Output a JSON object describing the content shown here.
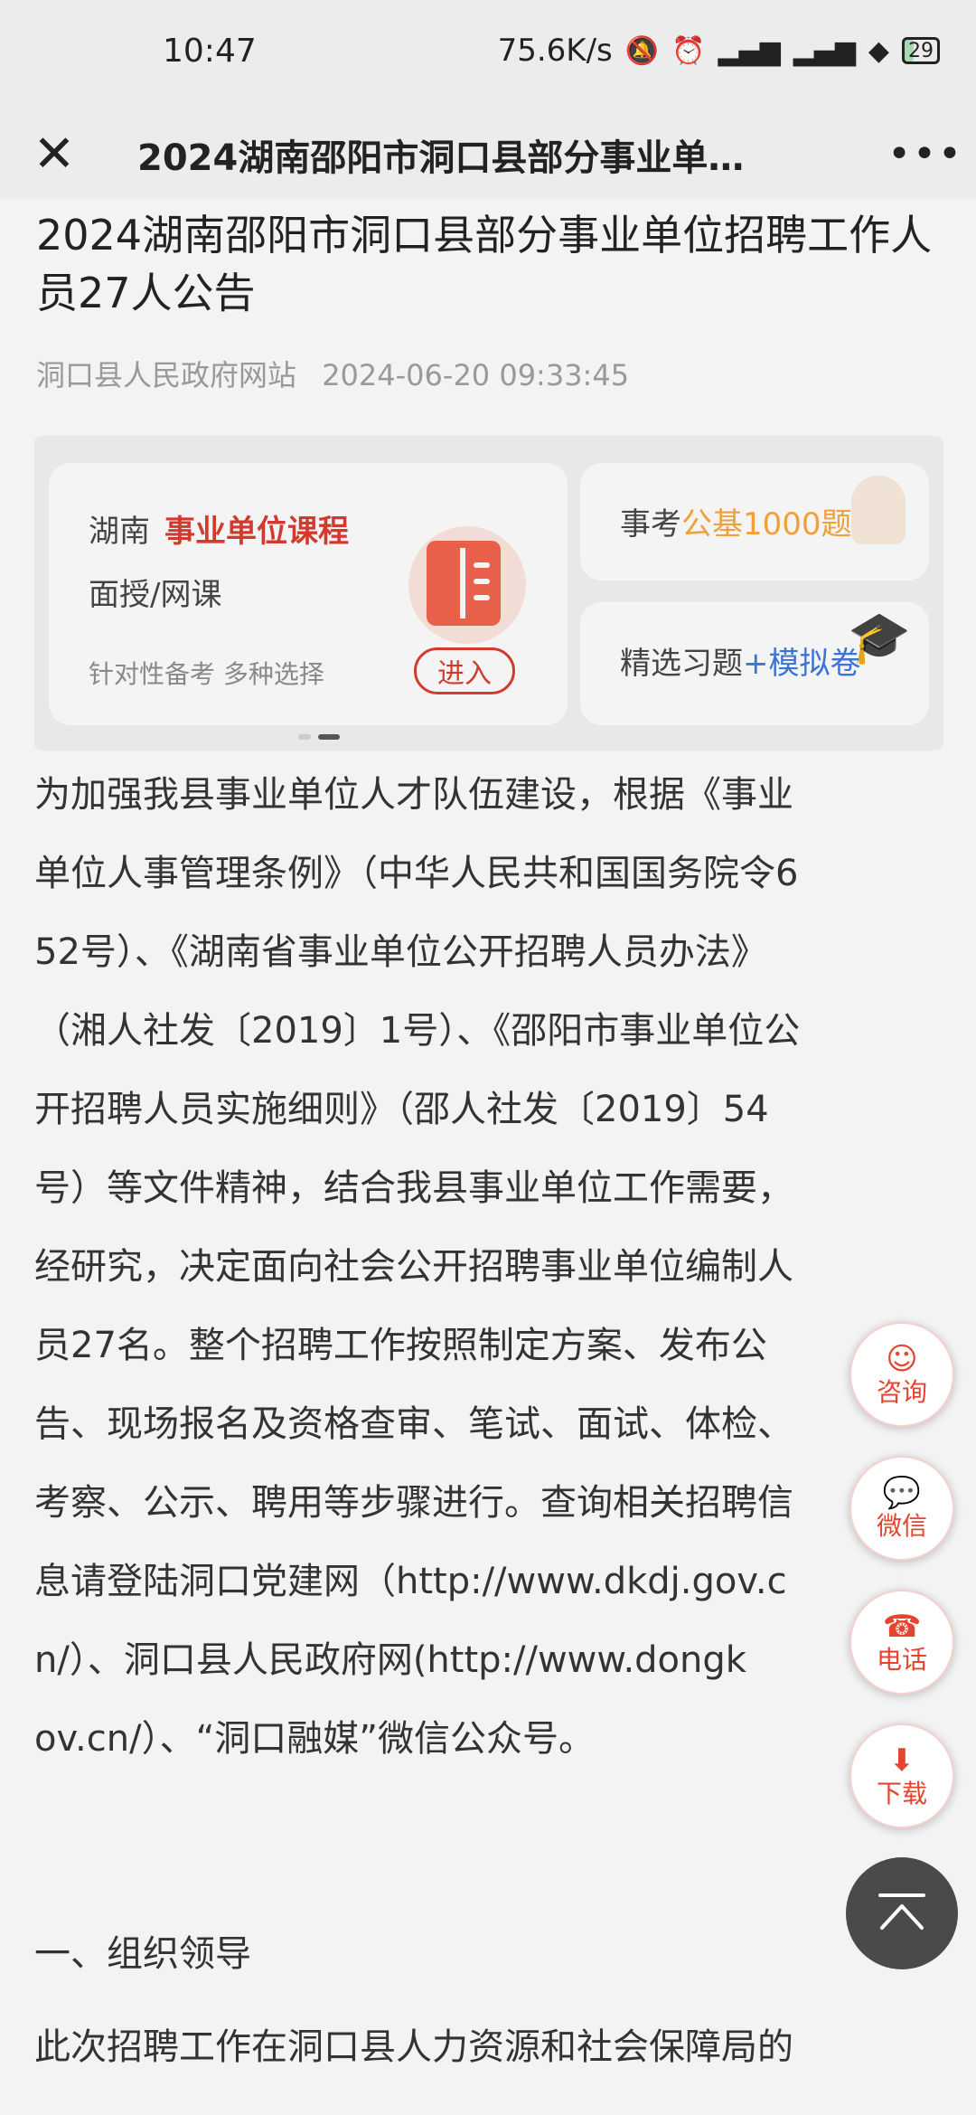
{
  "status_bar": {
    "time": "10:47",
    "speed": "75.6K/s",
    "battery": "29",
    "battery_level": 0.29
  },
  "nav": {
    "title": "2024湖南邵阳市洞口县部分事业单…"
  },
  "article": {
    "title": "2024湖南邵阳市洞口县部分事业单位招聘工作人员27人公告",
    "source": "洞口县人民政府网站",
    "datetime": "2024-06-20 09:33:45"
  },
  "ad": {
    "main": {
      "region": "湖南",
      "course": "事业单位课程",
      "mode": "面授/网课",
      "slogan": "针对性备考 多种选择",
      "enter": "进入"
    },
    "side1": {
      "prefix": "事考",
      "highlight": "公基1000题"
    },
    "side2": {
      "prefix": "精选习题",
      "highlight": "+模拟卷"
    }
  },
  "content": {
    "lines": [
      "为加强我县事业单位人才队伍建设，根据《事业",
      "单位人事管理条例》（中华人民共和国国务院令6",
      "52号）、《湖南省事业单位公开招聘人员办法》",
      "（湘人社发〔2019〕1号）、《邵阳市事业单位公",
      "开招聘人员实施细则》（邵人社发〔2019〕54",
      "号）等文件精神，结合我县事业单位工作需要，",
      "经研究，决定面向社会公开招聘事业单位编制人",
      "员27名。整个招聘工作按照制定方案、发布公",
      "告、现场报名及资格查审、笔试、面试、体检、",
      "考察、公示、聘用等步骤进行。查询相关招聘信",
      "息请登陆洞口党建网（http://www.dkdj.gov.c",
      "n/）、洞口县人民政府网(http://www.dongk",
      "ov.cn/）、“洞口融媒”微信公众号。"
    ],
    "section_heading": "一、组织领导",
    "section_line": "此次招聘工作在洞口县人力资源和社会保障局的"
  },
  "float_buttons": {
    "consult": "咨询",
    "wechat": "微信",
    "phone": "电话",
    "download": "下载"
  }
}
